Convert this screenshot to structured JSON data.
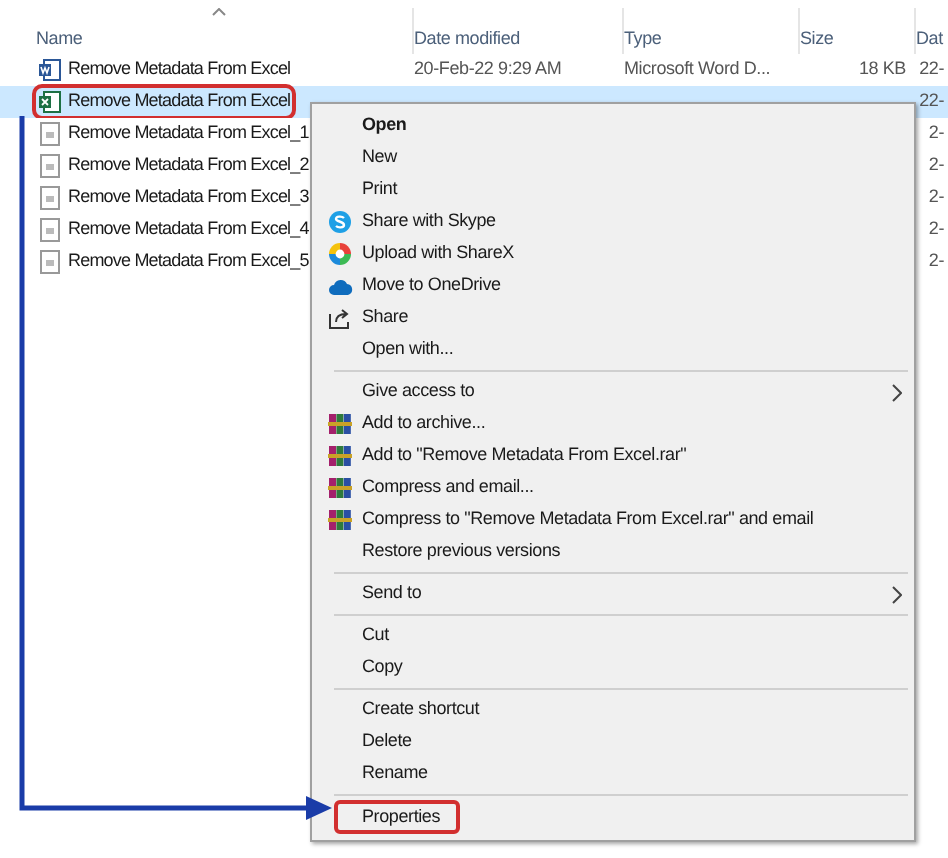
{
  "columns": [
    {
      "label": "Name",
      "sorted": true
    },
    {
      "label": "Date modified",
      "sorted": false
    },
    {
      "label": "Type",
      "sorted": false
    },
    {
      "label": "Size",
      "sorted": false
    },
    {
      "label": "Dat",
      "sorted": false
    }
  ],
  "files": [
    {
      "name": "Remove Metadata From Excel",
      "kind": "word",
      "selected": false,
      "annotated": false,
      "date": "20-Feb-22 9:29 AM",
      "type": "Microsoft Word D...",
      "size": "18 KB",
      "column_5": "22-"
    },
    {
      "name": "Remove Metadata From Excel",
      "kind": "excel",
      "selected": true,
      "annotated": true,
      "column_5": "22-"
    },
    {
      "name": "Remove Metadata From Excel_1",
      "kind": "generic",
      "selected": false,
      "annotated": false,
      "column_5": "2-"
    },
    {
      "name": "Remove Metadata From Excel_2",
      "kind": "generic",
      "selected": false,
      "annotated": false,
      "column_5": "2-"
    },
    {
      "name": "Remove Metadata From Excel_3",
      "kind": "generic",
      "selected": false,
      "annotated": false,
      "column_5": "2-"
    },
    {
      "name": "Remove Metadata From Excel_4",
      "kind": "generic",
      "selected": false,
      "annotated": false,
      "column_5": "2-"
    },
    {
      "name": "Remove Metadata From Excel_5",
      "kind": "generic",
      "selected": false,
      "annotated": false,
      "column_5": "2-"
    }
  ],
  "context_menu": {
    "groups": [
      [
        {
          "label": "Open",
          "default": true
        },
        {
          "label": "New"
        },
        {
          "label": "Print"
        },
        {
          "label": "Share with Skype",
          "kind": "skype"
        },
        {
          "label": "Upload with ShareX",
          "kind": "sharex"
        },
        {
          "label": "Move to OneDrive",
          "kind": "onedrive"
        },
        {
          "label": "Share",
          "kind": "share"
        },
        {
          "label": "Open with..."
        }
      ],
      [
        {
          "label": "Give access to",
          "submenu": true
        },
        {
          "label": "Add to archive...",
          "kind": "archive"
        },
        {
          "label": "Add to \"Remove Metadata From Excel.rar\"",
          "kind": "archive"
        },
        {
          "label": "Compress and email...",
          "kind": "archive"
        },
        {
          "label": "Compress to \"Remove Metadata From Excel.rar\" and email",
          "kind": "archive"
        },
        {
          "label": "Restore previous versions"
        }
      ],
      [
        {
          "label": "Send to",
          "submenu": true
        }
      ],
      [
        {
          "label": "Cut"
        },
        {
          "label": "Copy"
        }
      ],
      [
        {
          "label": "Create shortcut"
        },
        {
          "label": "Delete"
        },
        {
          "label": "Rename"
        }
      ],
      [
        {
          "label": "Properties",
          "annotated": true
        }
      ]
    ]
  }
}
